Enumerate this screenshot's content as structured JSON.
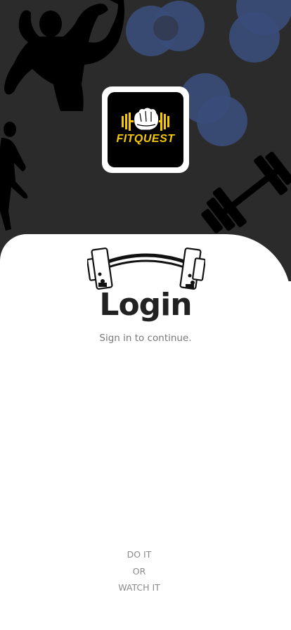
{
  "app": {
    "brand": "FITQUEST"
  },
  "colors": {
    "hero_background": "#2b2b2b",
    "circle_accent": "#3a4d7a",
    "brand_yellow": "#f5c800",
    "title": "#222222",
    "muted_text": "#777777"
  },
  "icons": {
    "logo": "fist-barbell-logo",
    "decor": [
      "bodybuilder-silhouette",
      "runner-silhouette",
      "dumbbell-silhouette",
      "barbell-icon"
    ]
  },
  "login": {
    "title": "Login",
    "subtitle": "Sign in to continue."
  },
  "footer": {
    "line1": "DO IT",
    "line2": "OR",
    "line3": "WATCH IT"
  }
}
